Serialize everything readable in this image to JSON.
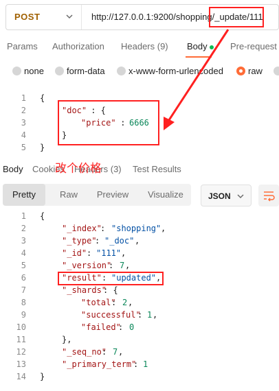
{
  "request": {
    "method": "POST",
    "url": "http://127.0.0.1:9200/shopping/_update/111"
  },
  "request_tabs": [
    {
      "label": "Params"
    },
    {
      "label": "Authorization"
    },
    {
      "label": "Headers (9)"
    },
    {
      "label": "Body"
    },
    {
      "label": "Pre-request"
    }
  ],
  "body_types": [
    {
      "label": "none"
    },
    {
      "label": "form-data"
    },
    {
      "label": "x-www-form-urlencoded"
    },
    {
      "label": "raw"
    }
  ],
  "request_body": {
    "lines": [
      "1",
      "2",
      "3",
      "4",
      "5"
    ],
    "open": "{",
    "doc_key": "\"doc\"",
    "doc_colon": " : {",
    "price_key": "\"price\"",
    "price_colon": " : ",
    "price_value": "6666",
    "inner_close": "}",
    "outer_close": "}"
  },
  "response_tabs": [
    {
      "label": "Body"
    },
    {
      "label": "Cookies"
    },
    {
      "label": "Headers (3)"
    },
    {
      "label": "Test Results"
    }
  ],
  "annotation": "改个价格",
  "view_modes": [
    {
      "label": "Pretty"
    },
    {
      "label": "Raw"
    },
    {
      "label": "Preview"
    },
    {
      "label": "Visualize"
    }
  ],
  "format": "JSON",
  "response_body": {
    "line_numbers": [
      "1",
      "2",
      "3",
      "4",
      "5",
      "6",
      "7",
      "8",
      "9",
      "10",
      "11",
      "12",
      "13",
      "14"
    ],
    "open": "{",
    "index_key": "\"_index\"",
    "index_val": "\"shopping\"",
    "type_key": "\"_type\"",
    "type_val": "\"_doc\"",
    "id_key": "\"_id\"",
    "id_val": "\"111\"",
    "version_key": "\"_version\"",
    "version_val": "7",
    "result_key": "\"result\"",
    "result_val": "\"updated\"",
    "shards_key": "\"_shards\"",
    "total_key": "\"total\"",
    "total_val": "2",
    "successful_key": "\"successful\"",
    "successful_val": "1",
    "failed_key": "\"failed\"",
    "failed_val": "0",
    "shards_close": "},",
    "seq_key": "\"_seq_no\"",
    "seq_val": "7",
    "primary_key": "\"_primary_term\"",
    "primary_val": "1",
    "close": "}"
  },
  "colors": {
    "accent": "#ff6c37",
    "highlight": "#ff2020",
    "method": "#a06000"
  }
}
